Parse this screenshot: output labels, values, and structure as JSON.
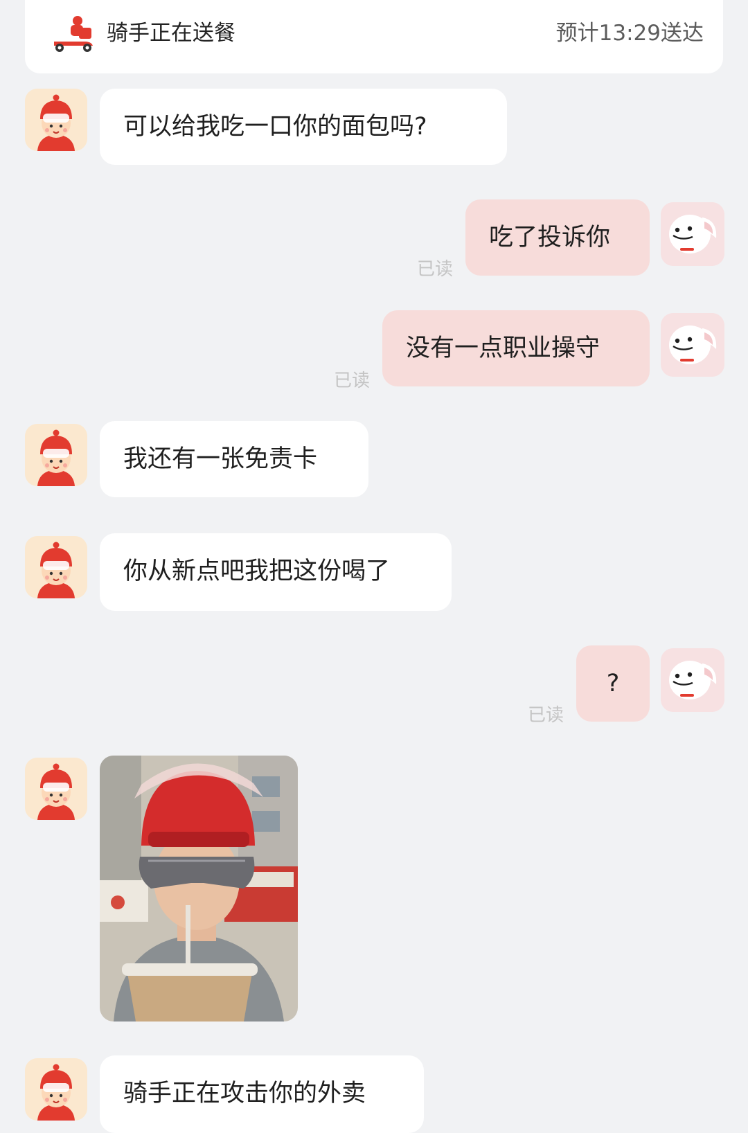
{
  "header": {
    "title": "骑手正在送餐",
    "eta": "预计13:29送达"
  },
  "messages": [
    {
      "sender": "rider",
      "text": "可以给我吃一口你的面包吗?"
    },
    {
      "sender": "me",
      "text": "吃了投诉你",
      "read": "已读"
    },
    {
      "sender": "me",
      "text": "没有一点职业操守",
      "read": "已读"
    },
    {
      "sender": "rider",
      "text": "我还有一张免责卡"
    },
    {
      "sender": "rider",
      "text": "你从新点吧我把这份喝了"
    },
    {
      "sender": "me",
      "text": "?",
      "read": "已读"
    },
    {
      "sender": "rider",
      "type": "photo"
    },
    {
      "sender": "rider",
      "text": "骑手正在攻击你的外卖"
    }
  ],
  "colors": {
    "background": "#f1f2f4",
    "incoming_bubble": "#ffffff",
    "outgoing_bubble": "#f7dcda",
    "accent_red": "#e23b2f"
  },
  "icons": {
    "header": "delivery-scooter-icon",
    "rider_avatar": "rider-helmet-avatar",
    "self_avatar": "white-dog-mascot-avatar"
  }
}
